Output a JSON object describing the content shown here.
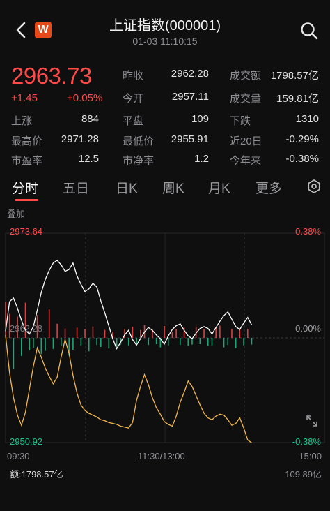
{
  "header": {
    "title": "上证指数(000001)",
    "time": "01-03 11:10:15",
    "logo": "W"
  },
  "quote": {
    "price": "2963.73",
    "change": "+1.45",
    "change_pct": "+0.05%"
  },
  "stats": {
    "prev_close_label": "昨收",
    "prev_close": "2962.28",
    "turnover_label": "成交额",
    "turnover": "1798.57亿",
    "open_label": "今开",
    "open": "2957.11",
    "volume_label": "成交量",
    "volume": "159.81亿",
    "up_label": "上涨",
    "up": "884",
    "flat_label": "平盘",
    "flat": "109",
    "down_label": "下跌",
    "down": "1310",
    "high_label": "最高价",
    "high": "2971.28",
    "low_label": "最低价",
    "low": "2955.91",
    "d20_label": "近20日",
    "d20": "-0.29%",
    "pe_label": "市盈率",
    "pe": "12.5",
    "pb_label": "市净率",
    "pb": "1.2",
    "ytd_label": "今年来",
    "ytd": "-0.38%"
  },
  "tabs": [
    "分时",
    "五日",
    "日K",
    "周K",
    "月K",
    "更多"
  ],
  "chart_labels": {
    "overlay": "叠加",
    "y_top": "2973.64",
    "y_mid": "2962.28",
    "y_bot": "2950.92",
    "pct_top": "0.38%",
    "pct_mid": "0.00%",
    "pct_bot": "-0.38%",
    "x_start": "09:30",
    "x_mid": "11:30/13:00",
    "x_end": "15:00",
    "vol_label": "额:1798.57亿",
    "vol_max": "109.89亿"
  },
  "chart_data": {
    "type": "line",
    "ylim": [
      2950.92,
      2973.64
    ],
    "series": [
      {
        "values": [
          2963.0,
          2966.2,
          2966.6,
          2965.5,
          2964.2,
          2963.1,
          2962.7,
          2963.5,
          2965.3,
          2967.2,
          2968.6,
          2969.6,
          2970.4,
          2970.7,
          2970.2,
          2969.5,
          2969.7,
          2970.4,
          2969.0,
          2968.1,
          2967.3,
          2967.6,
          2968.2,
          2967.8,
          2966.3,
          2965.0,
          2963.6,
          2962.2,
          2961.1,
          2961.8,
          2962.6,
          2963.1,
          2962.1,
          2961.5,
          2962.2,
          2962.9,
          2963.4,
          2963.1,
          2962.6,
          2962.2,
          2961.6,
          2962.5,
          2963.2,
          2963.6,
          2963.8,
          2963.1,
          2962.5,
          2962.2,
          2962.8,
          2963.3,
          2963.5,
          2963.3,
          2962.7,
          2963.4,
          2964.1,
          2964.7,
          2965.1,
          2964.3,
          2963.5,
          2963.2,
          2963.9,
          2964.5,
          2963.7
        ]
      },
      {
        "values": [
          2962.6,
          2958.5,
          2955.8,
          2953.9,
          2952.8,
          2954.2,
          2956.7,
          2959.2,
          2961.2,
          2960.2,
          2959.0,
          2958.1,
          2957.3,
          2958.0,
          2960.2,
          2962.1,
          2960.6,
          2958.2,
          2956.3,
          2955.0,
          2954.4,
          2954.1,
          2953.9,
          2953.7,
          2953.4,
          2953.3,
          2953.1,
          2953.0,
          2952.9,
          2952.7,
          2952.6,
          2952.5,
          2953.1,
          2955.5,
          2957.0,
          2958.3,
          2957.2,
          2955.8,
          2954.7,
          2954.0,
          2953.2,
          2952.9,
          2952.7,
          2953.8,
          2955.3,
          2956.4,
          2957.6,
          2957.0,
          2956.0,
          2955.0,
          2954.1,
          2953.6,
          2953.4,
          2953.8,
          2954.0,
          2953.9,
          2953.4,
          2952.8,
          2953.0,
          2953.6,
          2952.5,
          2951.2,
          2950.9
        ]
      }
    ],
    "volume": [
      9.2,
      6.1,
      7.8,
      5.4,
      4.6,
      8.9,
      3.2,
      2.5,
      5.8,
      4.1,
      3.3,
      7.2,
      2.8,
      3.6,
      2.1,
      2.4,
      4.5,
      3.0,
      2.6,
      1.9,
      2.2,
      3.4,
      2.9,
      1.8,
      2.3,
      2.0,
      2.7,
      1.6,
      2.5,
      1.7,
      2.2,
      1.9,
      2.8,
      1.5,
      2.0,
      3.2,
      1.8,
      2.1,
      1.6,
      2.4,
      3.0,
      1.9,
      1.5,
      2.2,
      1.8,
      2.6,
      2.0,
      1.7,
      2.9,
      1.6,
      2.3,
      2.0,
      1.9,
      2.7,
      3.1,
      2.4,
      1.8,
      2.2,
      2.6,
      2.1,
      1.9,
      2.3,
      1.7
    ],
    "volume_up": [
      true,
      true,
      false,
      true,
      false,
      true,
      false,
      false,
      true,
      false,
      false,
      true,
      false,
      true,
      false,
      true,
      false,
      false,
      true,
      false,
      true,
      false,
      true,
      false,
      false,
      true,
      false,
      true,
      false,
      false,
      true,
      false,
      true,
      false,
      true,
      true,
      false,
      true,
      false,
      false,
      true,
      false,
      true,
      true,
      false,
      true,
      false,
      false,
      true,
      false,
      true,
      false,
      false,
      true,
      true,
      false,
      false,
      true,
      false,
      true,
      false,
      true,
      false
    ],
    "ylabel": "",
    "xlabel": ""
  },
  "colors": {
    "up": "#ff4a4a",
    "down": "#19c38b",
    "line_price": "#ffffff",
    "line_avg": "#f2b84b",
    "bg": "#0f0f10"
  }
}
